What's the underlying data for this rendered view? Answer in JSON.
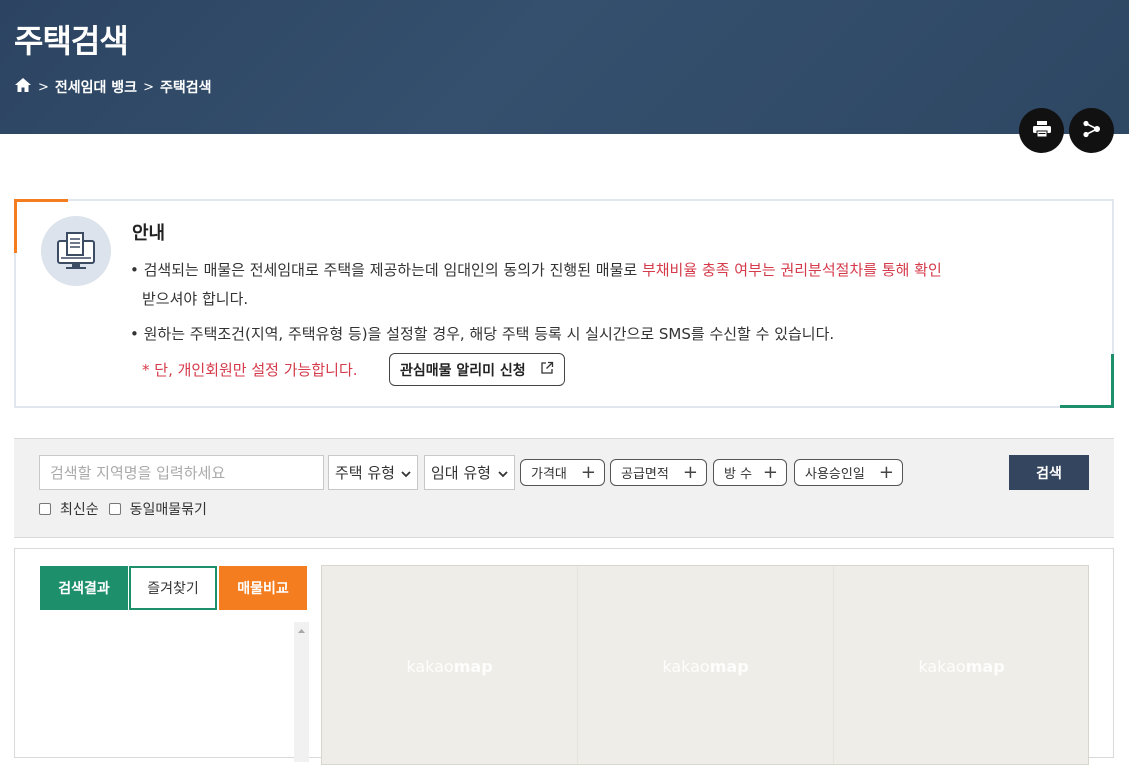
{
  "header": {
    "title": "주택검색",
    "breadcrumb": [
      "전세임대 뱅크",
      "주택검색"
    ]
  },
  "actions": {
    "print_icon": "printer-icon",
    "share_icon": "share-icon"
  },
  "notice": {
    "title": "안내",
    "line1_prefix": "• 검색되는 매물은 전세임대로 주택을 제공하는데 임대인의 동의가 진행된 매물로 ",
    "line1_highlight": "부채비율 충족 여부는 권리분석절차를 통해 확인",
    "line1_cont": "받으셔야 합니다.",
    "line2": "• 원하는 주택조건(지역, 주택유형 등)을 설정할 경우, 해당 주택 등록 시 실시간으로 SMS를 수신할 수 있습니다.",
    "note": "* 단, 개인회원만 설정 가능합니다.",
    "alarm_button": "관심매물 알리미 신청"
  },
  "search": {
    "placeholder": "검색할 지역명을 입력하세요",
    "house_type": "주택 유형",
    "lease_type": "임대 유형",
    "filters": [
      "가격대",
      "공급면적",
      "방 수",
      "사용승인일"
    ],
    "button": "검색",
    "checkbox_latest": "최신순",
    "checkbox_group": "동일매물묶기"
  },
  "tabs": {
    "results": "검색결과",
    "favorites": "즐겨찾기",
    "compare": "매물비교"
  },
  "map": {
    "tiles": [
      {
        "prefix": "kakao",
        "suffix": "map"
      },
      {
        "prefix": "kakao",
        "suffix": "map"
      },
      {
        "prefix": "kakao",
        "suffix": "map"
      }
    ]
  },
  "colors": {
    "header_bg": "#2f4866",
    "accent_orange": "#f47d20",
    "accent_green": "#1d8f6b",
    "highlight_red": "#d53b4b",
    "search_button": "#34465f"
  }
}
